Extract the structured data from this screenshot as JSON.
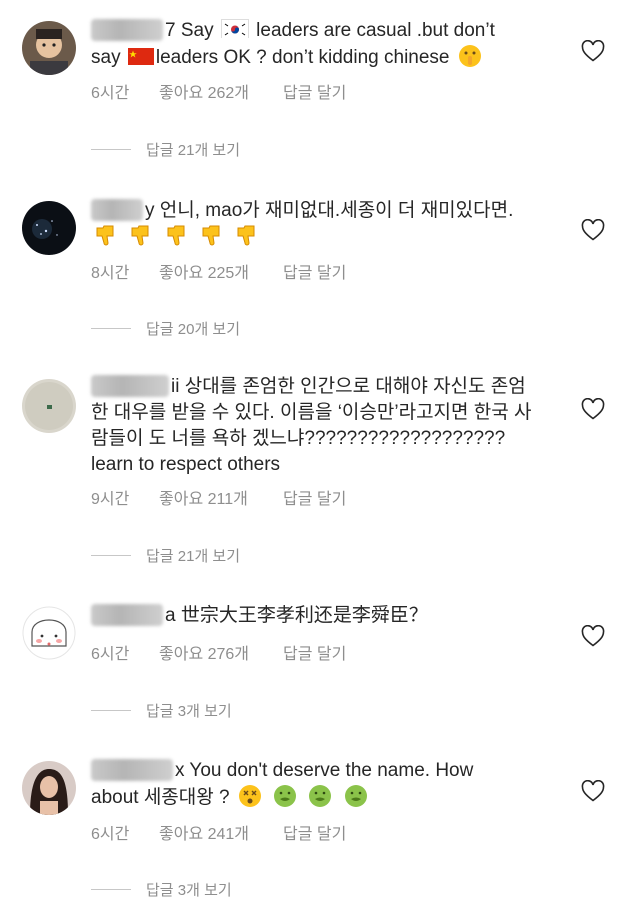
{
  "comments": [
    {
      "text_before": "7 Say",
      "text_after": "leaders are casual .but don’t",
      "line2_prefix": "say",
      "line2_after": "leaders OK ? don’t kidding chinese",
      "flag1": "south-korea-flag",
      "flag2": "china-flag",
      "emoji": "shushing-face-emoji",
      "time": "6시간",
      "likes": "좋아요 262개",
      "reply": "답글 달기",
      "view_replies": "답글 21개 보기"
    },
    {
      "text": "y 언니, mao가 재미없대.세종이 더 재미있다면.",
      "emoji": "thumbs-down-emoji",
      "emoji_count": 5,
      "time": "8시간",
      "likes": "좋아요 225개",
      "reply": "답글 달기",
      "view_replies": "답글 20개 보기"
    },
    {
      "line1": "ii 상대를 존엄한 인간으로 대해야 자신도 존엄",
      "line2": "한 대우를 받을 수 있다. 이름을 ‘이승만’라고지면 한국 사",
      "line3": "람들이 도 너를 욕하 겠느냐???????????????????",
      "line4": "learn to respect others",
      "time": "9시간",
      "likes": "좋아요 211개",
      "reply": "답글 달기",
      "view_replies": "답글 21개 보기"
    },
    {
      "text": "a 世宗大王李孝利还是李舜臣？",
      "time": "6시간",
      "likes": "좋아요 276개",
      "reply": "답글 달기",
      "view_replies": "답글 3개 보기"
    },
    {
      "line1": "x You don't deserve the name. How",
      "line2": "about 세종대왕 ?",
      "emoji1": "dizzy-face-emoji",
      "emoji2": "nauseated-face-emoji",
      "time": "6시간",
      "likes": "좋아요 241개",
      "reply": "답글 달기",
      "view_replies": "답글 3개 보기"
    }
  ],
  "colors": {
    "text": "#262626",
    "meta": "#8e8e8e",
    "divider": "#c7c7c7"
  }
}
